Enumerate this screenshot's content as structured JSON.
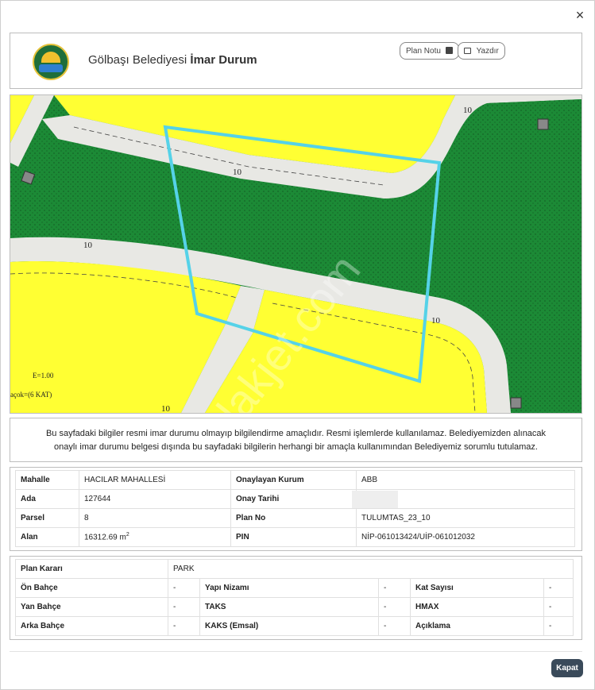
{
  "header": {
    "title_prefix": "Gölbaşı Belediyesi ",
    "title_bold": "İmar Durum",
    "plan_notu_label": "Plan Notu",
    "yazdir_label": "Yazdır",
    "close_symbol": "×"
  },
  "map": {
    "labels": [
      "10",
      "10",
      "10",
      "10",
      "10"
    ],
    "e_label": "E=1.00",
    "kat_label": "açok=(6 KAT)",
    "watermark": "emlakjet.com",
    "colors": {
      "yellow": "#ffff33",
      "green": "#1c8a36",
      "road": "#e8e8e4",
      "parcel": "#55d2e8"
    }
  },
  "notice": {
    "line1": "Bu sayfadaki bilgiler resmi imar durumu olmayıp bilgilendirme amaçlıdır. Resmi işlemlerde kullanılamaz. Belediyemizden alınacak",
    "line2": "onaylı imar durumu belgesi dışında bu sayfadaki bilgilerin herhangi bir amaçla kullanımından Belediyemiz sorumlu tutulamaz."
  },
  "info": {
    "mahalle_label": "Mahalle",
    "mahalle": "HACILAR MAHALLESİ",
    "kurum_label": "Onaylayan Kurum",
    "kurum": "ABB",
    "ada_label": "Ada",
    "ada": "127644",
    "tarih_label": "Onay Tarihi",
    "tarih": "",
    "parsel_label": "Parsel",
    "parsel": "8",
    "planno_label": "Plan No",
    "planno": "TULUMTAS_23_10",
    "alan_label": "Alan",
    "alan": "16312.69 m",
    "alan_unit_sup": "2",
    "pin_label": "PIN",
    "pin": "NİP-061013424/UİP-061012032"
  },
  "plan": {
    "karar_label": "Plan Kararı",
    "karar": "PARK",
    "on_bahce_label": "Ön Bahçe",
    "on_bahce": "-",
    "yapi_nizami_label": "Yapı Nizamı",
    "yapi_nizami": "-",
    "kat_sayisi_label": "Kat Sayısı",
    "kat_sayisi": "-",
    "yan_bahce_label": "Yan Bahçe",
    "yan_bahce": "-",
    "taks_label": "TAKS",
    "taks": "-",
    "hmax_label": "HMAX",
    "hmax": "-",
    "arka_bahce_label": "Arka Bahçe",
    "arka_bahce": "-",
    "kaks_label": "KAKS (Emsal)",
    "kaks": "-",
    "aciklama_label": "Açıklama",
    "aciklama": "-"
  },
  "footer": {
    "kapat_label": "Kapat"
  }
}
